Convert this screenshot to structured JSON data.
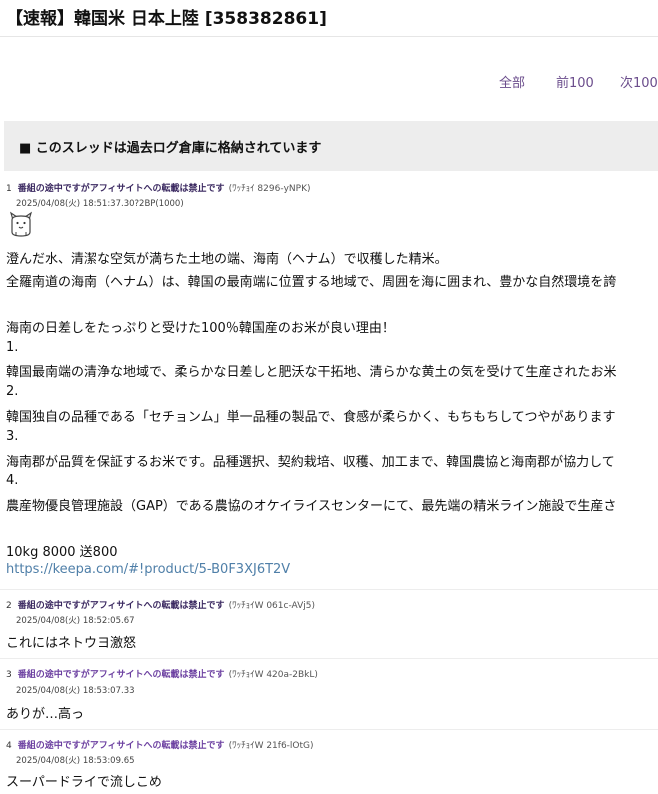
{
  "thread": {
    "title": "【速報】韓国米 日本上陸 [358382861]"
  },
  "pager": {
    "all": "全部",
    "prev100": "前100",
    "next100": "次100"
  },
  "archive_notice": "■ このスレッドは過去ログ倉庫に格納されています",
  "posts": [
    {
      "num": "1",
      "name": "番組の途中ですがアフィサイトへの転載は禁止です",
      "id": "(ﾜｯﾁｮｲ 8296-yNPK)",
      "date": "2025/04/08(火) 18:51:37.30?2BP(1000)",
      "body": [
        "澄んだ水、清潔な空気が満ちた土地の端、海南（ヘナム）で収穫した精米。",
        "全羅南道の海南（ヘナム）は、韓国の最南端に位置する地域で、周囲を海に囲まれ、豊かな自然環境を誇",
        "",
        "海南の日差しをたっぷりと受けた100％韓国産のお米が良い理由！",
        "1.",
        "韓国最南端の清浄な地域で、柔らかな日差しと肥沃な干拓地、清らかな黄土の気を受けて生産されたお米",
        "2.",
        "韓国独自の品種である「セチョンム」単一品種の製品で、食感が柔らかく、もちもちしてつやがあります",
        "3.",
        "海南郡が品質を保証するお米です。品種選択、契約栽培、収穫、加工まで、韓国農協と海南郡が協力して",
        "4.",
        "農産物優良管理施設（GAP）である農協のオケイライスセンターにて、最先端の精米ライン施設で生産さ",
        "",
        "10kg 8000 送800"
      ],
      "link": "https://keepa.com/#!product/5-B0F3XJ6T2V"
    },
    {
      "num": "2",
      "name": "番組の途中ですがアフィサイトへの転載は禁止です",
      "id": "(ﾜｯﾁｮｲW 061c-AVj5)",
      "date": "2025/04/08(火) 18:52:05.67",
      "body": [
        "これにはネトウヨ激怒"
      ]
    },
    {
      "num": "3",
      "name": "番組の途中ですがアフィサイトへの転載は禁止です",
      "id": "(ﾜｯﾁｮｲW 420a-2BkL)",
      "date": "2025/04/08(火) 18:53:07.33",
      "body": [
        "ありが…高っ"
      ]
    },
    {
      "num": "4",
      "name": "番組の途中ですがアフィサイトへの転載は禁止です",
      "id": "(ﾜｯﾁｮｲW 21f6-lOtG)",
      "date": "2025/04/08(火) 18:53:09.65",
      "body": [
        "スーパードライで流しこめ"
      ]
    }
  ],
  "colors": {
    "name": "#3a2860",
    "name_link": "#6b3fa0",
    "pager": "#6b4d8c",
    "url": "#4f7fa8",
    "banner_bg": "#ededed"
  },
  "icons": {
    "be-icon": "small ascii cat/hamster face"
  }
}
